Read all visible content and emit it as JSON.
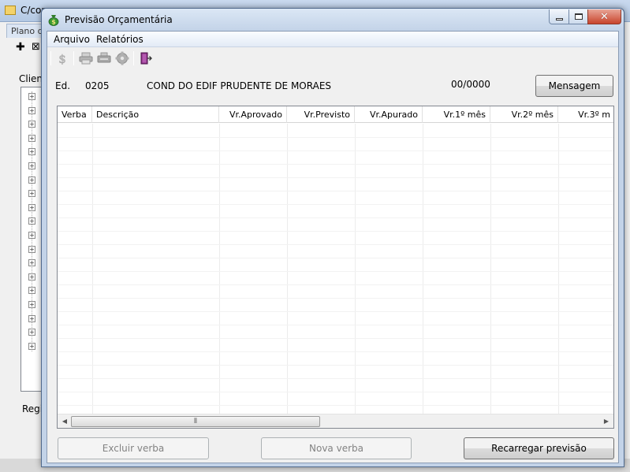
{
  "background_app": {
    "title": "C/con",
    "tab_label": "Plano d",
    "clients_label": "Client",
    "bottom_label": "Regi"
  },
  "dialog": {
    "title": "Previsão Orçamentária",
    "menu": [
      {
        "label": "Arquivo"
      },
      {
        "label": "Relatórios"
      }
    ],
    "toolbar": [
      "dollar-icon",
      "printer-icon",
      "printer-alt-icon",
      "gear-icon",
      "exit-door-icon"
    ],
    "header": {
      "ed_label": "Ed.",
      "ed_code": "0205",
      "ed_name": "COND DO EDIF PRUDENTE DE MORAES",
      "period": "00/0000",
      "message_button": "Mensagem"
    },
    "grid": {
      "columns": [
        {
          "label": "Verba"
        },
        {
          "label": "Descrição"
        },
        {
          "label": "Vr.Aprovado"
        },
        {
          "label": "Vr.Previsto"
        },
        {
          "label": "Vr.Apurado"
        },
        {
          "label": "Vr.1º mês"
        },
        {
          "label": "Vr.2º mês"
        },
        {
          "label": "Vr.3º m"
        }
      ],
      "rows": []
    },
    "buttons": {
      "delete_item": "Excluir verba",
      "new_item": "Nova verba",
      "reload": "Recarregar previsão"
    }
  },
  "colors": {
    "title_bar": "#c3d3e8",
    "close_button": "#c8442c",
    "exit_icon": "#7a2a7a"
  }
}
